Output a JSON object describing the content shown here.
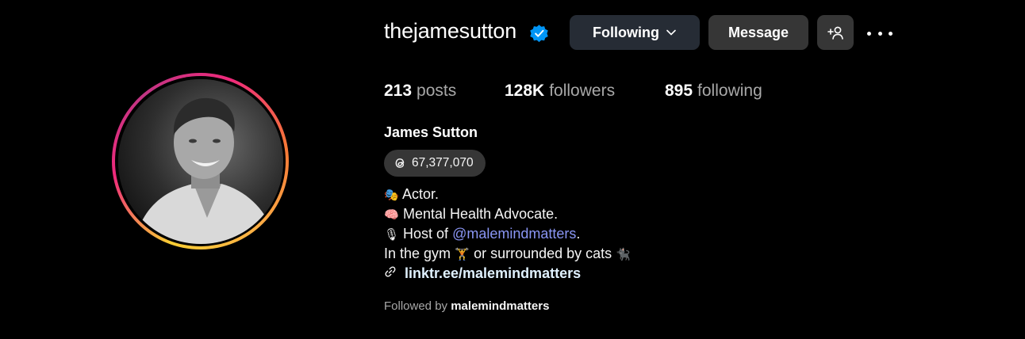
{
  "profile": {
    "username": "thejamesutton",
    "verified_icon": "verified-badge-icon",
    "full_name": "James Sutton"
  },
  "actions": {
    "following_label": "Following",
    "message_label": "Message",
    "add_user_icon": "add-user-icon",
    "more_icon": "more-horizontal-icon"
  },
  "stats": {
    "posts_count": "213",
    "posts_label": "posts",
    "followers_count": "128K",
    "followers_label": "followers",
    "following_count": "895",
    "following_label": "following"
  },
  "threads": {
    "icon": "threads-icon",
    "count": "67,377,070"
  },
  "bio": {
    "line1_emoji": "🎭",
    "line1_text": "Actor.",
    "line2_emoji": "🧠",
    "line2_text": "Mental Health Advocate.",
    "line3_emoji": "🎙",
    "line3_prefix": "Host of",
    "line3_mention": "@malemindmatters",
    "line3_suffix": ".",
    "line4_prefix": "In the gym",
    "line4_emoji1": "🏋",
    "line4_middle": "or surrounded by cats",
    "line4_emoji2": "🐈‍⬛",
    "link_icon": "link-icon",
    "link_text": "linktr.ee/malemindmatters"
  },
  "followed_by": {
    "prefix": "Followed by",
    "user": "malemindmatters"
  },
  "colors": {
    "background": "#000000",
    "following_button": "#262c35",
    "button": "#363636",
    "mention": "#8a96f5",
    "verified": "#0095f6"
  }
}
